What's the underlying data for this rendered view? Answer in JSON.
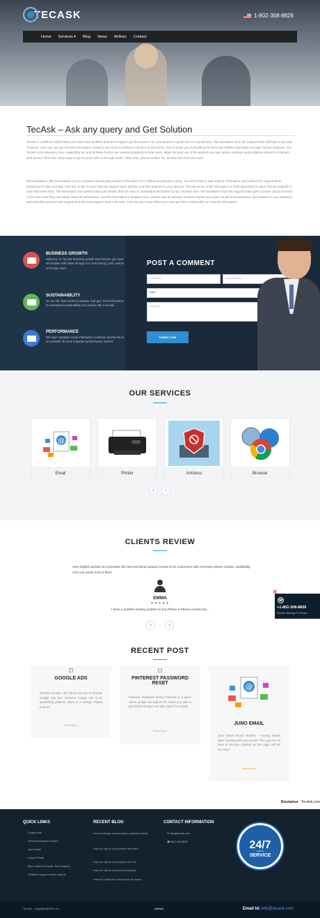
{
  "header": {
    "brand": "TECASK",
    "phone": "1-802-308-8826",
    "nav": [
      "Home",
      "Services ▾",
      "Blog",
      "News",
      "Airlines",
      "Contact"
    ]
  },
  "intro": {
    "title": "TecAsk – Ask any query and Get Solution",
    "paragraph1": "Tecask is a platform which helps you when face problem and need support, get the answers for your queries in quick time for any devices. The assistance from the support team will help in any kind of issues. Here you can get relevant information related to any kind of problem in devices in quick time. This is helps you in providing the best and reliable information through various mediums. The Tecask is for relevancy, time, availability etc and all these factors are covered positively to help users. Make the best use of the platform and get various solutions and problems solved in minimum time period. There are many ways to get in touch with us through email, online chat, phone number etc. Get the best from the team.",
    "paragraph2": "Best assistance with fast solution is very important and tecask provides information 24*7 without any break or delay. You don't have to wait long for information and solution the support team assistance is easy and fast. Feel free to get in touch with the support team anytime you face problem in your devices. The relevancy of the information is most important for users and we maintain it each and every time. The information has desired steps and details that are easy to understand and follow by any common user. The assistance from the support team gives a better clarity of issues to the users and they can easily follow the information. Get the information in simplest form, easiest way by relevant medium anytime you want. So get best assistance and solution for you problems with seamless process and support from the best support team with ease. Don't let your issue affect your work get them solved with our relevant information."
  },
  "features": [
    {
      "title": "BUSINESS GROWTH",
      "text": "Welcome to TecAsk business growth has tremors get more informative with ideas through our recent blogs, post, events and many more.",
      "color": "#d9534f"
    },
    {
      "title": "SUSTAINABILITY",
      "text": "we are the best technical adviser and give best information to maintained sustainability at a certain rate in tecask.",
      "color": "#5cb85c"
    },
    {
      "title": "PERFORMANCE",
      "text": "We have complete many information customer service list at our website for more important performance metrics.",
      "color": "#3a7bd5"
    }
  ],
  "comment_form": {
    "title": "POST A COMMENT",
    "name_placeholder": "Full Name",
    "email_placeholder": "Email Address",
    "select_value": "Hello",
    "message_placeholder": "Message",
    "submit_label": "SUBMIT NOW"
  },
  "services": {
    "title": "OUR SERVICES",
    "items": [
      {
        "label": "Email",
        "icon": "email-icon"
      },
      {
        "label": "Printer",
        "icon": "printer-icon"
      },
      {
        "label": "Antivirus",
        "icon": "antivirus-icon"
      },
      {
        "label": "Browser",
        "icon": "browser-icon"
      }
    ],
    "prev": "‹",
    "next": "›"
  },
  "review": {
    "title": "CLIENTS REVIEW",
    "quote": "Very helpful website as it provides the best technical support service to its customers with 24*seven phone number availability. One can easily trust in them",
    "name": "EMMA",
    "stars": "★★★★★",
    "text": "I have a problem testing problem in my iPhone 6 Please contact too..",
    "prev": "‹",
    "next": "›"
  },
  "phone_widget": {
    "number": "+1-802-308-8826",
    "subtitle": "Number Belongs To Tecask",
    "close": "✕"
  },
  "recent_post": {
    "title": "RECENT POST",
    "posts": [
      {
        "title": "GOOGLE ADS",
        "text": "Remove Google Ads Check out how to remove Google Ads free. Remove Google Ads is an advertising platform which is a Google related product.",
        "more": "Read More"
      },
      {
        "title": "PINTEREST PASSWORD RESET",
        "text": "Pinterest Password Reset Pinterest is a place where people can explore the world, you able to get desired images and also share the tutorial.",
        "more": "Read More"
      },
      {
        "title": "JUNO EMAIL",
        "text": "Juno Email Phone Number - Having issues while working with Juno email? Then you do not have to become clueless as this page will tell you how t",
        "more": "Read More"
      }
    ]
  },
  "disclaimer": {
    "label": "Disclaimer",
    "text": " : TecAsk.com"
  },
  "footer": {
    "quick_links_title": "QUICK LINKS",
    "quick_links": [
      "Google Ads",
      "Pinterest Password Reset",
      "Juno Email",
      "Canon Printer",
      "Best Online Computer Tech Support",
      "Software support means easy fix"
    ],
    "recent_blog_title": "RECENT BLOG",
    "recent_blog": [
      "How to change amazon prime password online",
      "How do I talk to a live person at Delta?",
      "How do I talk to a live person at KLM",
      "How do I talk to someone at Expedia",
      "How do I speak to a live person at Yahoo"
    ],
    "contact_title": "CONTACT INFORMATION",
    "contact_email": "info@tecask.com",
    "contact_phone": "802-308-8826",
    "badge_main": "24/7",
    "badge_sub": "HOURS",
    "badge_service": "SERVICE",
    "copyright": "TecAsk - copyright@2018-19",
    "airlines": "Airlines",
    "email_label": "Email Id:",
    "email_value": "info@tecask.com"
  }
}
